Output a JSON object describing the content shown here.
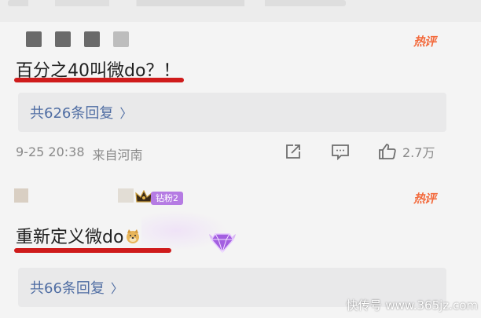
{
  "comments": [
    {
      "hot_label": "热评",
      "text": "百分之40叫微do？！",
      "replies_label": "共626条回复",
      "timestamp": "9-25 20:38",
      "location": "来自河南",
      "likes": "2.7万"
    },
    {
      "hot_label": "热评",
      "fan_badge": "钻粉2",
      "text": "重新定义微do",
      "replies_label": "共66条回复"
    }
  ],
  "watermark": "快传号 www.365jz.com",
  "colors": {
    "underline": "#cf1b1b",
    "hot": "#f36a3c",
    "link": "#4f6da3",
    "badge": "#b57be3"
  }
}
